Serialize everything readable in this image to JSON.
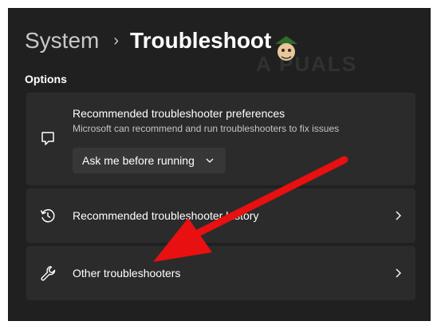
{
  "breadcrumb": {
    "parent": "System",
    "separator": "›",
    "current": "Troubleshoot"
  },
  "watermark": {
    "text": "A PUALS",
    "icon": "appuals-mascot-logo"
  },
  "options": {
    "label": "Options",
    "cards": [
      {
        "title": "Recommended troubleshooter preferences",
        "description": "Microsoft can recommend and run troubleshooters to fix issues",
        "icon": "chat-bubble-icon",
        "dropdown": {
          "value": "Ask me before running",
          "icon": "chevron-down-icon"
        }
      },
      {
        "title": "Recommended troubleshooter history",
        "icon": "history-icon",
        "chevron": "chevron-right-icon"
      },
      {
        "title": "Other troubleshooters",
        "icon": "wrench-icon",
        "chevron": "chevron-right-icon"
      }
    ]
  },
  "annotation": {
    "type": "red-arrow",
    "color": "#e81010",
    "points_to": "Other troubleshooters"
  },
  "colors": {
    "window_bg": "#202020",
    "card_bg": "#2b2b2b",
    "dropdown_bg": "#373737",
    "text_primary": "#ffffff",
    "text_secondary": "#c5c5c5",
    "arrow": "#e81010"
  }
}
